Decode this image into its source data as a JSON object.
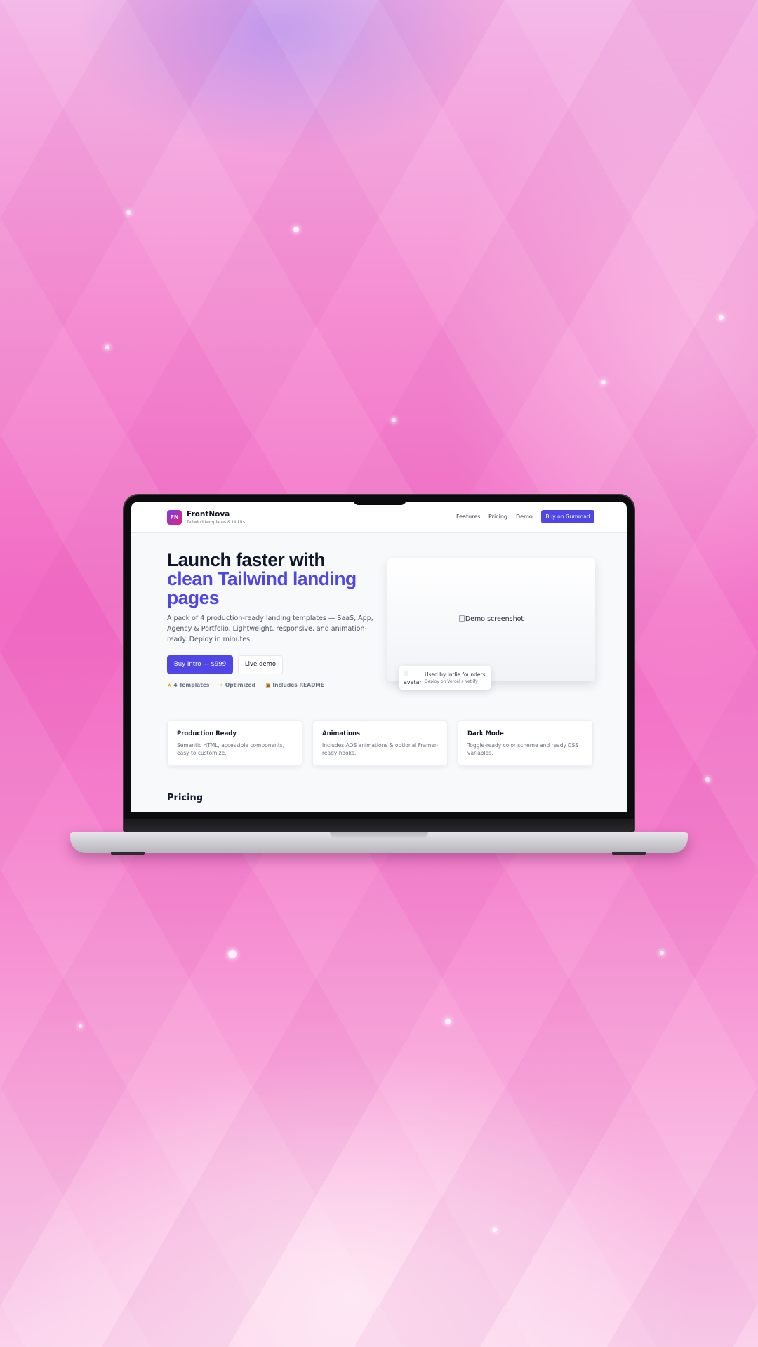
{
  "nav": {
    "logo_text": "FN",
    "brand": "FrontNova",
    "tagline": "Tailwind templates & UI kits",
    "links": [
      {
        "label": "Features"
      },
      {
        "label": "Pricing"
      },
      {
        "label": "Demo"
      }
    ],
    "cta": "Buy on Gumroad"
  },
  "hero": {
    "title_line1": "Launch faster with",
    "title_accent": "clean Tailwind landing pages",
    "description": "A pack of 4 production-ready landing templates — SaaS, App, Agency & Portfolio. Lightweight, responsive, and animation-ready. Deploy in minutes.",
    "primary_button": "Buy Intro — $999",
    "secondary_button": "Live demo",
    "badges": [
      {
        "icon": "star-icon",
        "label": "4 Templates"
      },
      {
        "icon": "lightning-icon",
        "label": "Optimized"
      },
      {
        "icon": "package-icon",
        "label": "Includes README"
      }
    ],
    "demo_alt": "Demo screenshot",
    "founder_card": {
      "avatar_alt": "avatar",
      "title": "Used by indie founders",
      "subtitle": "Deploy on Vercel / Netlify"
    }
  },
  "features": [
    {
      "title": "Production Ready",
      "description": "Semantic HTML, accessible components, easy to customize."
    },
    {
      "title": "Animations",
      "description": "Includes AOS animations & optional Framer-ready hooks."
    },
    {
      "title": "Dark Mode",
      "description": "Toggle-ready color scheme and ready CSS variables."
    }
  ],
  "pricing": {
    "title": "Pricing"
  },
  "colors": {
    "accent": "#4f46e5",
    "heading": "#0f172a",
    "background_pink": "#f26bc4"
  }
}
